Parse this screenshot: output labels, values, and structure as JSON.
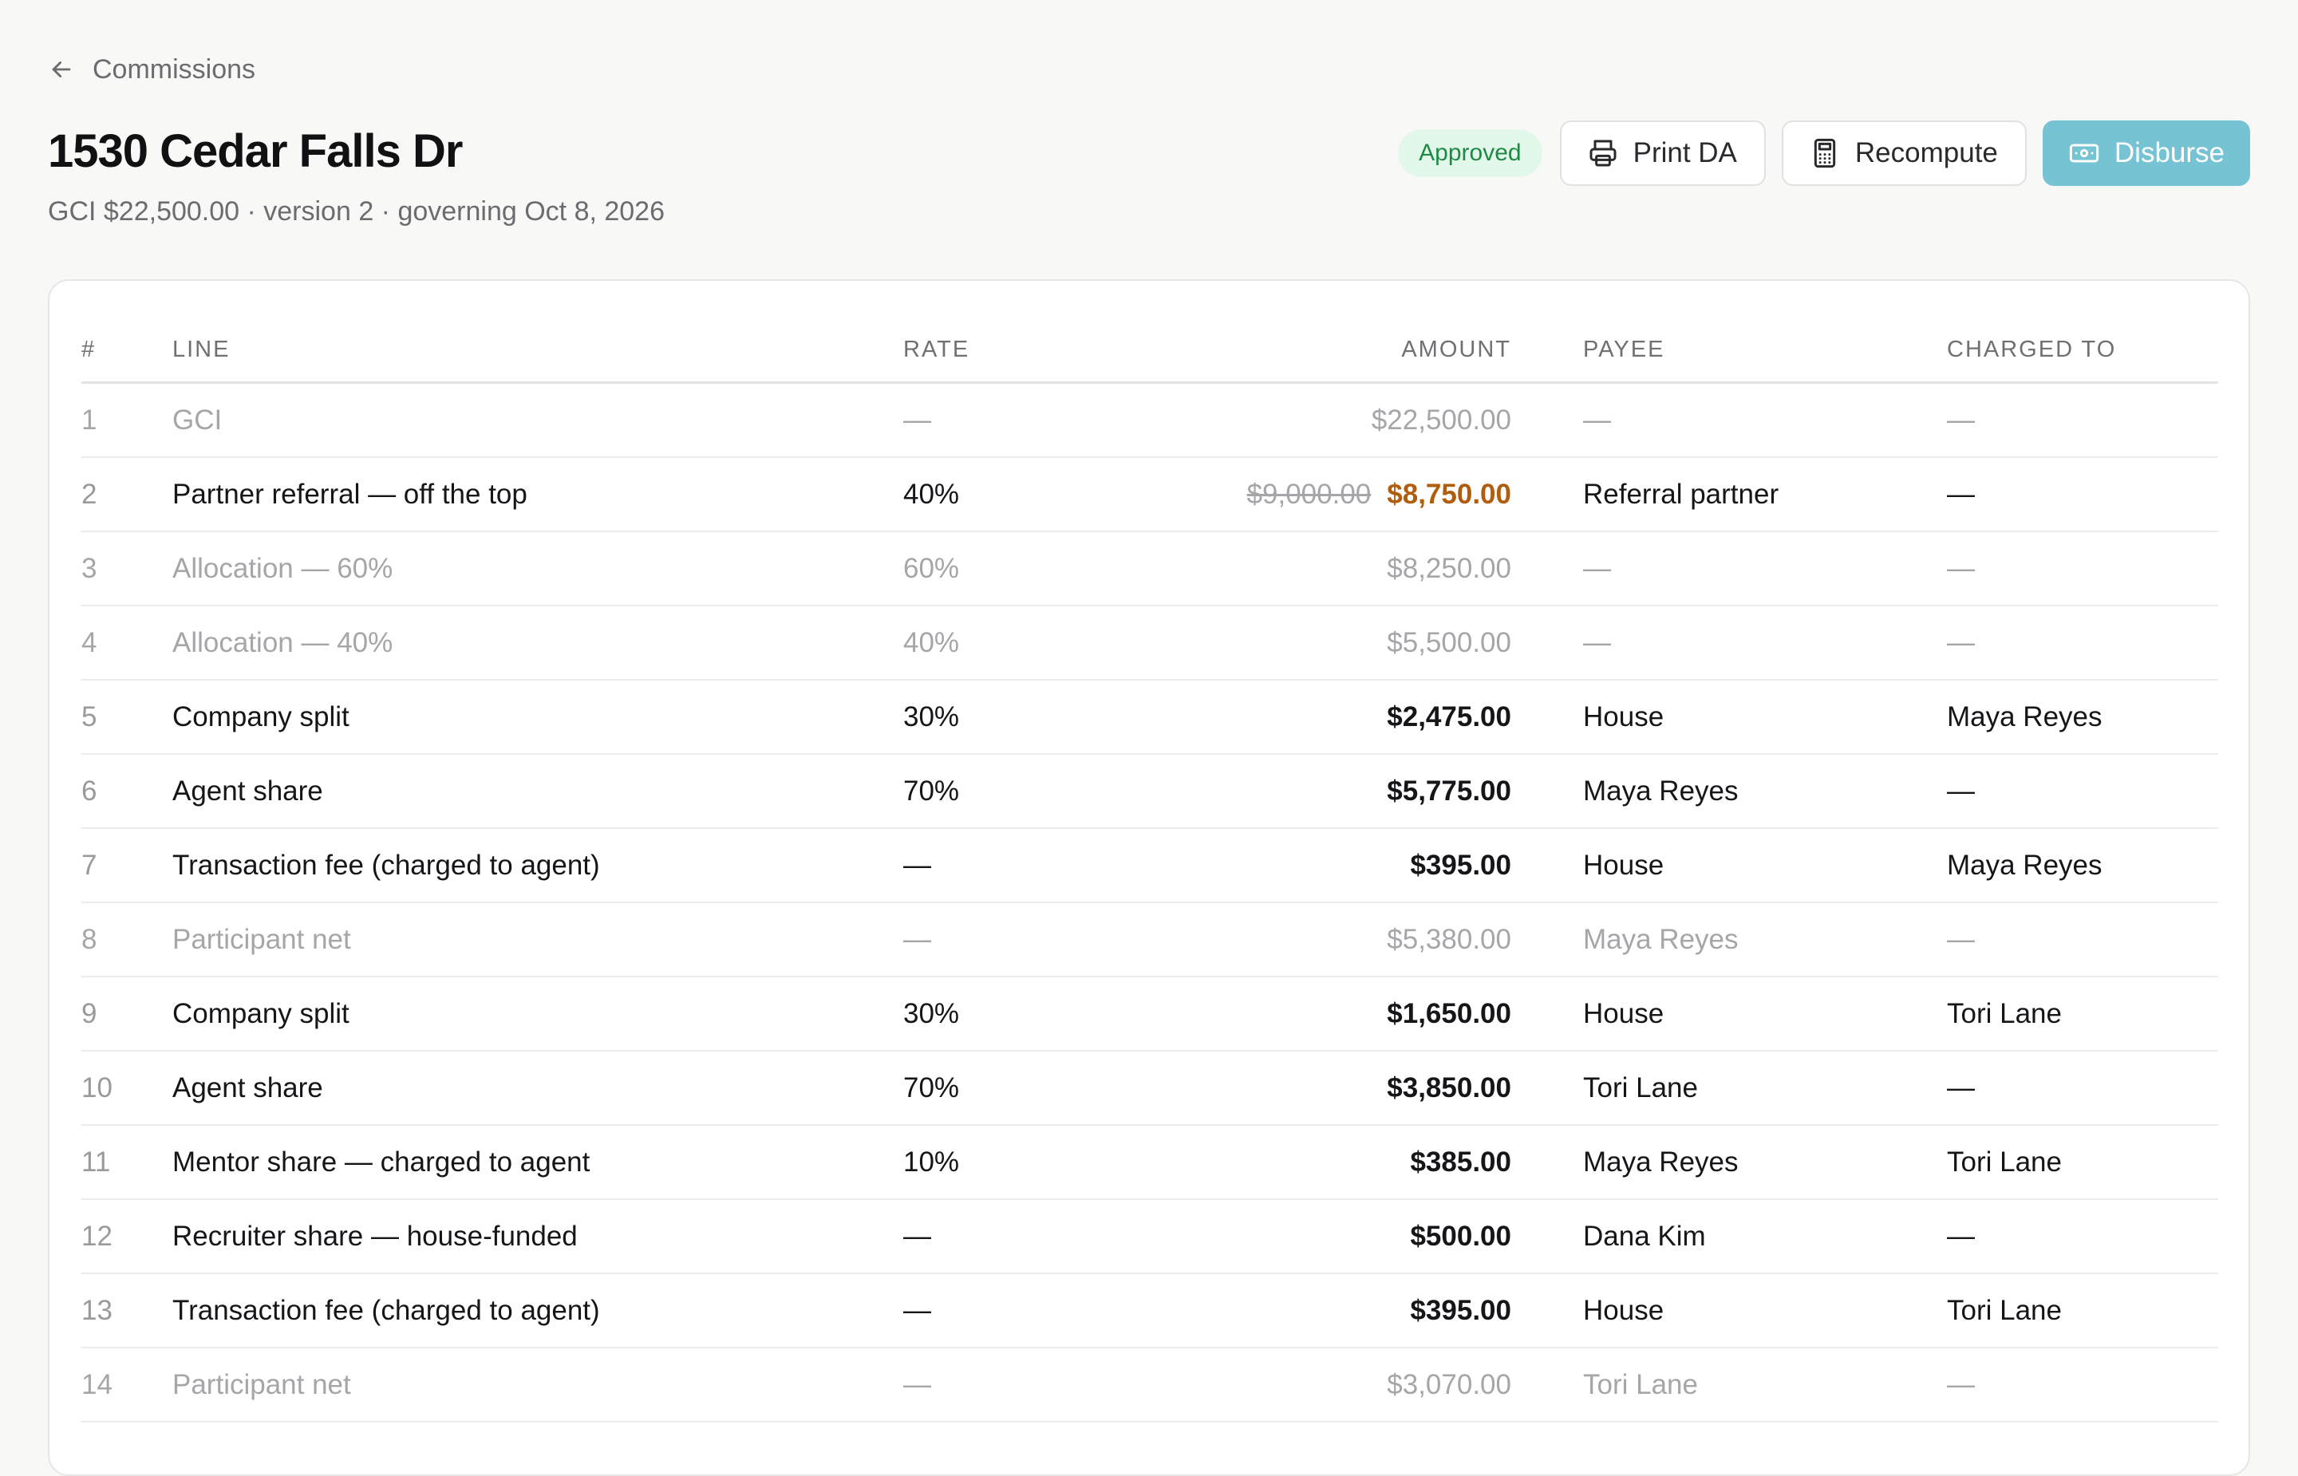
{
  "back": {
    "label": "Commissions"
  },
  "title": "1530 Cedar Falls Dr",
  "subtitle": "GCI $22,500.00 · version 2 · governing Oct 8, 2026",
  "status": {
    "label": "Approved",
    "color": "#1f8a46",
    "background": "#e2f8ea"
  },
  "actions": {
    "print_label": "Print DA",
    "recompute_label": "Recompute",
    "disburse_label": "Disburse"
  },
  "colors": {
    "accent": "#76c3d3",
    "adjusted": "#b15d0e"
  },
  "icons": {
    "back": "arrow-left-icon",
    "print": "printer-icon",
    "recompute": "calculator-icon",
    "disburse": "banknote-icon"
  },
  "table": {
    "headers": {
      "num": "#",
      "line": "LINE",
      "rate": "RATE",
      "amount": "AMOUNT",
      "payee": "PAYEE",
      "charged_to": "CHARGED TO"
    },
    "rows": [
      {
        "num": "1",
        "line": "GCI",
        "rate": "—",
        "amount": "$22,500.00",
        "payee": "—",
        "charged_to": "—",
        "muted": true
      },
      {
        "num": "2",
        "line": "Partner referral — off the top",
        "rate": "40%",
        "amount_original": "$9,000.00",
        "amount": "$8,750.00",
        "payee": "Referral partner",
        "charged_to": "—",
        "muted": false
      },
      {
        "num": "3",
        "line": "Allocation — 60%",
        "rate": "60%",
        "amount": "$8,250.00",
        "payee": "—",
        "charged_to": "—",
        "muted": true
      },
      {
        "num": "4",
        "line": "Allocation — 40%",
        "rate": "40%",
        "amount": "$5,500.00",
        "payee": "—",
        "charged_to": "—",
        "muted": true
      },
      {
        "num": "5",
        "line": "Company split",
        "rate": "30%",
        "amount": "$2,475.00",
        "payee": "House",
        "charged_to": "Maya Reyes",
        "muted": false
      },
      {
        "num": "6",
        "line": "Agent share",
        "rate": "70%",
        "amount": "$5,775.00",
        "payee": "Maya Reyes",
        "charged_to": "—",
        "muted": false
      },
      {
        "num": "7",
        "line": "Transaction fee (charged to agent)",
        "rate": "—",
        "amount": "$395.00",
        "payee": "House",
        "charged_to": "Maya Reyes",
        "muted": false
      },
      {
        "num": "8",
        "line": "Participant net",
        "rate": "—",
        "amount": "$5,380.00",
        "payee": "Maya Reyes",
        "charged_to": "—",
        "muted": true
      },
      {
        "num": "9",
        "line": "Company split",
        "rate": "30%",
        "amount": "$1,650.00",
        "payee": "House",
        "charged_to": "Tori Lane",
        "muted": false
      },
      {
        "num": "10",
        "line": "Agent share",
        "rate": "70%",
        "amount": "$3,850.00",
        "payee": "Tori Lane",
        "charged_to": "—",
        "muted": false
      },
      {
        "num": "11",
        "line": "Mentor share — charged to agent",
        "rate": "10%",
        "amount": "$385.00",
        "payee": "Maya Reyes",
        "charged_to": "Tori Lane",
        "muted": false
      },
      {
        "num": "12",
        "line": "Recruiter share — house-funded",
        "rate": "—",
        "amount": "$500.00",
        "payee": "Dana Kim",
        "charged_to": "—",
        "muted": false
      },
      {
        "num": "13",
        "line": "Transaction fee (charged to agent)",
        "rate": "—",
        "amount": "$395.00",
        "payee": "House",
        "charged_to": "Tori Lane",
        "muted": false
      },
      {
        "num": "14",
        "line": "Participant net",
        "rate": "—",
        "amount": "$3,070.00",
        "payee": "Tori Lane",
        "charged_to": "—",
        "muted": true
      }
    ]
  }
}
